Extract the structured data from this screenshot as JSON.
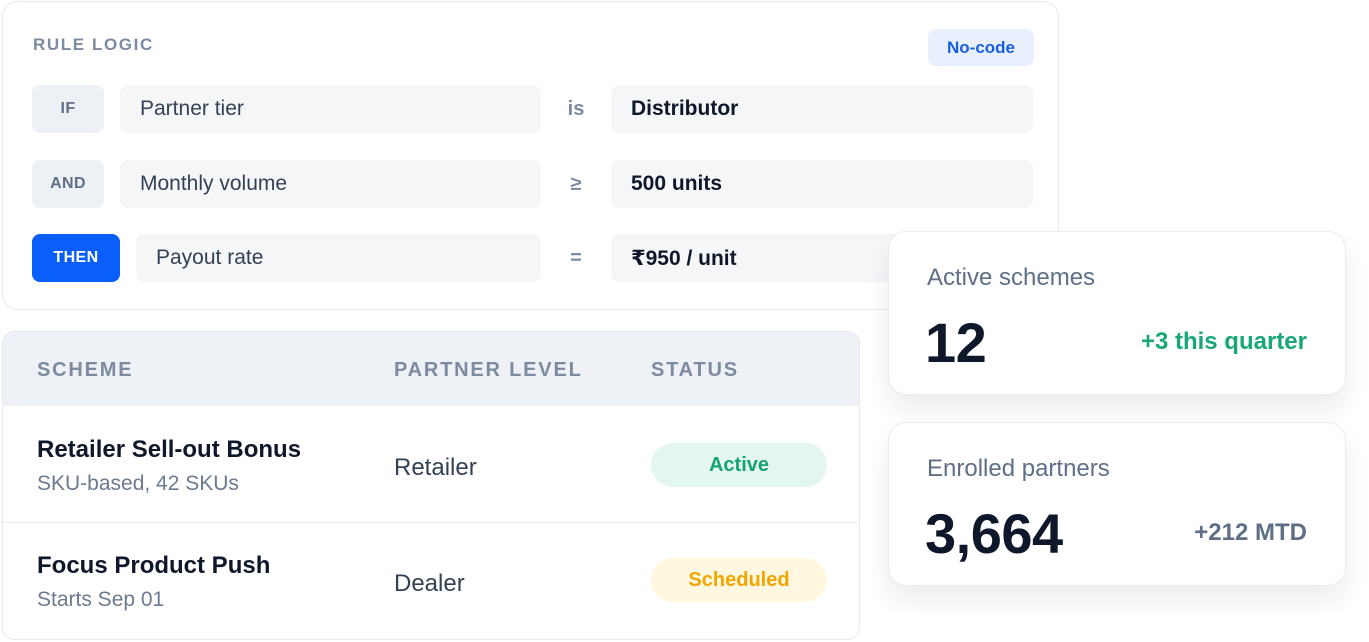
{
  "rule_logic": {
    "heading": "RULE LOGIC",
    "badge": "No-code",
    "rows": [
      {
        "keyword": "IF",
        "field": "Partner tier",
        "operator": "is",
        "value": "Distributor"
      },
      {
        "keyword": "AND",
        "field": "Monthly volume",
        "operator": "≥",
        "value": "500 units"
      },
      {
        "keyword": "THEN",
        "field": "Payout rate",
        "operator": "=",
        "value": "₹950 / unit"
      }
    ]
  },
  "schemes_table": {
    "columns": [
      "SCHEME",
      "PARTNER LEVEL",
      "STATUS"
    ],
    "rows": [
      {
        "name": "Retailer Sell-out Bonus",
        "detail": "SKU-based, 42 SKUs",
        "partner_level": "Retailer",
        "status": "Active"
      },
      {
        "name": "Focus Product Push",
        "detail": "Starts Sep 01",
        "partner_level": "Dealer",
        "status": "Scheduled"
      }
    ]
  },
  "stats": {
    "active_schemes": {
      "label": "Active schemes",
      "value": "12",
      "delta": "+3 this quarter"
    },
    "enrolled_partners": {
      "label": "Enrolled partners",
      "value": "3,664",
      "delta": "+212 MTD"
    }
  },
  "colors": {
    "accent_blue": "#0a5ffc",
    "active_bg": "#e3f6ef",
    "active_text": "#16a36f",
    "scheduled_bg": "#fff7e0",
    "scheduled_text": "#f0a500",
    "positive_delta": "#19a77a",
    "neutral_delta": "#5f6f87"
  }
}
